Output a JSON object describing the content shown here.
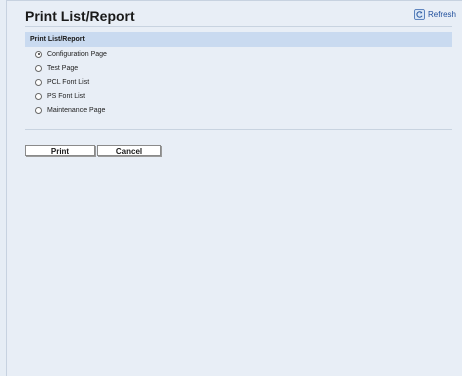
{
  "header": {
    "title": "Print List/Report",
    "refresh_label": "Refresh"
  },
  "section": {
    "title": "Print List/Report",
    "options": [
      {
        "label": "Configuration Page",
        "checked": true
      },
      {
        "label": "Test Page",
        "checked": false
      },
      {
        "label": "PCL Font List",
        "checked": false
      },
      {
        "label": "PS Font List",
        "checked": false
      },
      {
        "label": "Maintenance Page",
        "checked": false
      }
    ]
  },
  "actions": {
    "print_label": "Print",
    "cancel_label": "Cancel"
  },
  "icons": {
    "refresh": "refresh-icon"
  },
  "colors": {
    "background": "#e8eef6",
    "section_header": "#c9daf0",
    "link": "#1f4e9c"
  }
}
